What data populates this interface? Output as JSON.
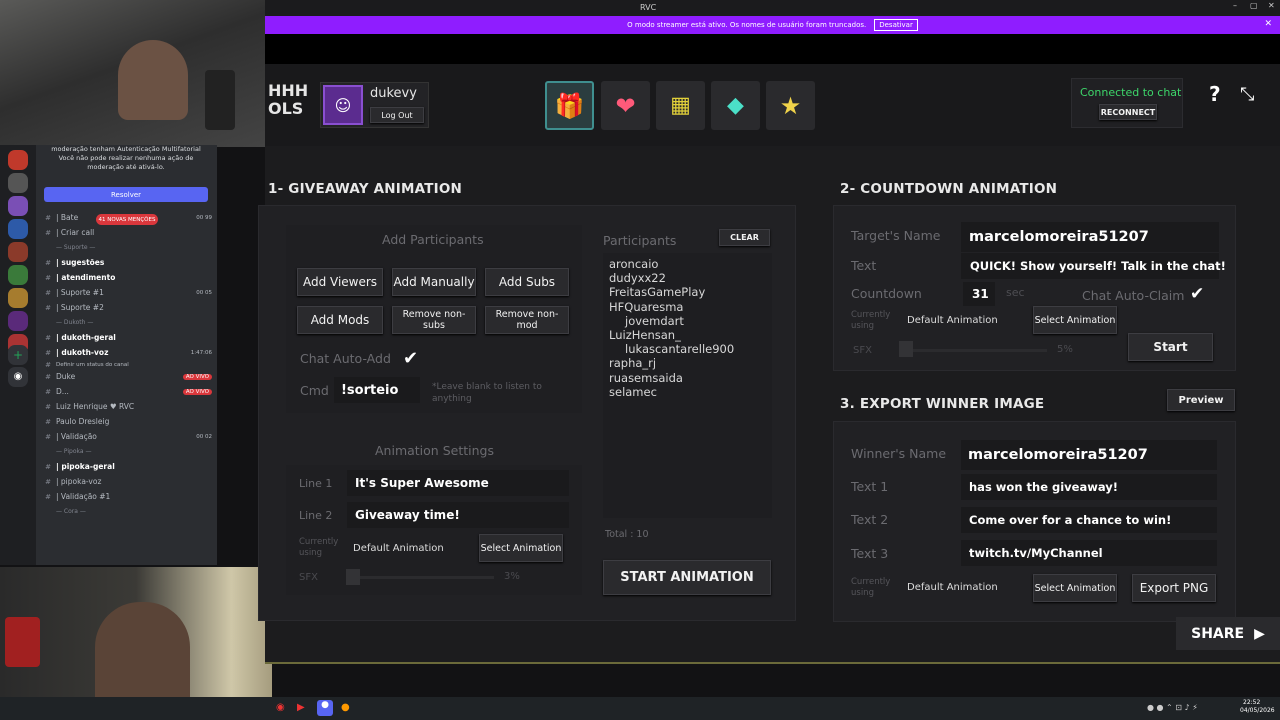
{
  "window": {
    "title": "RVC"
  },
  "banner": {
    "text": "O modo streamer está ativo. Os nomes de usuário foram truncados.",
    "button": "Desativar"
  },
  "header": {
    "logo_lines": [
      "HHH",
      "OLS"
    ],
    "username": "dukevy",
    "logout": "Log Out",
    "status": "Connected to chat",
    "reconnect": "RECONNECT",
    "help": "?"
  },
  "giveaway": {
    "title": "1- GIVEAWAY ANIMATION",
    "add_participants": "Add Participants",
    "buttons": {
      "add_viewers": "Add Viewers",
      "add_manually": "Add Manually",
      "add_subs": "Add Subs",
      "add_mods": "Add Mods",
      "remove_nonsubs": "Remove non-subs",
      "remove_nonmod": "Remove non-mod"
    },
    "chat_auto_add": "Chat Auto-Add",
    "cmd_label": "Cmd",
    "cmd_value": "!sorteio",
    "cmd_hint": "*Leave blank to listen to anything",
    "participants_title": "Participants",
    "clear": "CLEAR",
    "participants": [
      "aroncaio",
      "dudyxx22",
      "FreitasGamePlay",
      "HFQuaresma",
      "jovemdart",
      "LuizHensan_",
      "lukascantarelle900",
      "rapha_rj",
      "ruasemsaida",
      "selamec"
    ],
    "total": "Total : 10",
    "start": "START ANIMATION",
    "settings_title": "Animation Settings",
    "line1_label": "Line 1",
    "line1": "It's Super Awesome",
    "line2_label": "Line 2",
    "line2": "Giveaway time!",
    "currently_using": "Currently using",
    "default_animation": "Default Animation",
    "select_animation": "Select Animation",
    "sfx": "SFX",
    "sfx_value": "3%"
  },
  "countdown": {
    "title": "2- COUNTDOWN ANIMATION",
    "target_label": "Target's Name",
    "target": "marcelomoreira51207",
    "text_label": "Text",
    "text": "QUICK! Show yourself! Talk in the chat!",
    "countdown_label": "Countdown",
    "countdown": "31",
    "sec": "sec",
    "auto_claim": "Chat Auto-Claim",
    "currently_using": "Currently using",
    "default_animation": "Default Animation",
    "select_animation": "Select Animation",
    "start": "Start",
    "sfx": "SFX",
    "sfx_value": "5%"
  },
  "export": {
    "title": "3. EXPORT WINNER IMAGE",
    "preview": "Preview",
    "winner_label": "Winner's Name",
    "winner": "marcelomoreira51207",
    "t1_label": "Text 1",
    "t1": "has won the giveaway!",
    "t2_label": "Text 2",
    "t2": "Come over for a chance to win!",
    "t3_label": "Text 3",
    "t3": "twitch.tv/MyChannel",
    "currently_using": "Currently using",
    "default_animation": "Default Animation",
    "select_animation": "Select Animation",
    "export_png": "Export PNG",
    "share": "SHARE"
  },
  "discord": {
    "notice1": "moderação tenham Autenticação Multifatorial",
    "notice2": "Você não pode realizar nenhuma ação de moderação até ativá-lo.",
    "resolve": "Resolver",
    "mentions": "41 NOVAS MENÇÕES",
    "channels": [
      {
        "name": "| Bate",
        "meta": "00 99"
      },
      {
        "name": "| Criar call",
        "meta": ""
      },
      {
        "name": "— Suporte —",
        "meta": ""
      },
      {
        "name": "| sugestões",
        "meta": ""
      },
      {
        "name": "| atendimento",
        "meta": ""
      },
      {
        "name": "| Suporte #1",
        "meta": "00 05"
      },
      {
        "name": "| Suporte #2",
        "meta": ""
      },
      {
        "name": "— Dukoth —",
        "meta": ""
      },
      {
        "name": "| dukoth-geral",
        "meta": ""
      },
      {
        "name": "| dukoth-voz",
        "meta": "1:47:06"
      },
      {
        "name": "Definir um status do canal",
        "meta": ""
      },
      {
        "name": "Duke",
        "meta": "AO VIVO"
      },
      {
        "name": "D...",
        "meta": "AO VIVO"
      },
      {
        "name": "Luiz Henrique ♥ RVC",
        "meta": ""
      },
      {
        "name": "Paulo Dresleig",
        "meta": ""
      },
      {
        "name": "| Validação",
        "meta": "00 02"
      },
      {
        "name": "— Pipoka —",
        "meta": ""
      },
      {
        "name": "| pipoka-geral",
        "meta": ""
      },
      {
        "name": "| pipoka-voz",
        "meta": ""
      },
      {
        "name": "| Validação #1",
        "meta": ""
      },
      {
        "name": "— Cora —",
        "meta": ""
      }
    ]
  },
  "taskbar": {
    "time": "22:52",
    "date": "04/05/2026"
  }
}
